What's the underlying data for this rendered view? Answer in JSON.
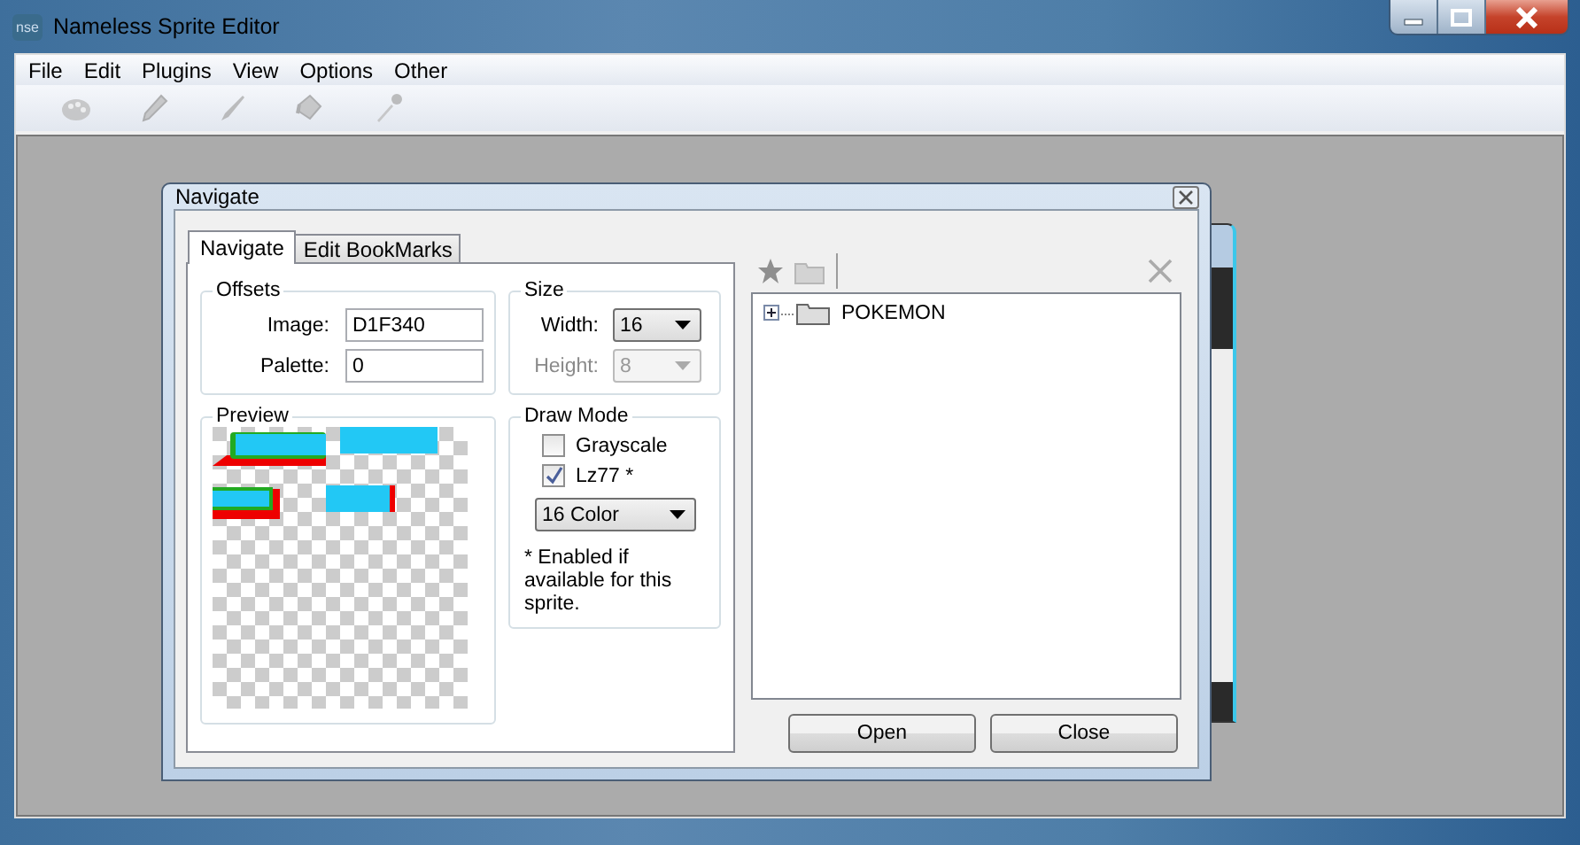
{
  "window": {
    "title": "Nameless Sprite Editor",
    "app_badge": "nse"
  },
  "menu": [
    "File",
    "Edit",
    "Plugins",
    "View",
    "Options",
    "Other"
  ],
  "toolbar": [
    {
      "kind": "palette",
      "disabled": true
    },
    {
      "kind": "pencil",
      "disabled": true
    },
    {
      "kind": "brush",
      "disabled": true
    },
    {
      "kind": "bucket",
      "disabled": true
    },
    {
      "kind": "dropper",
      "disabled": true
    }
  ],
  "dialog": {
    "title": "Navigate",
    "tabs": [
      {
        "label": "Navigate",
        "selected": true
      },
      {
        "label": "Edit BookMarks",
        "selected": false
      }
    ],
    "offsets": {
      "title": "Offsets",
      "fields": [
        {
          "label": "Image:",
          "value": "D1F340"
        },
        {
          "label": "Palette:",
          "value": "0"
        }
      ]
    },
    "size": {
      "title": "Size",
      "fields": [
        {
          "label": "Width:",
          "value": "16",
          "disabled": false
        },
        {
          "label": "Height:",
          "value": "8",
          "disabled": true
        }
      ]
    },
    "preview": {
      "title": "Preview"
    },
    "draw_mode": {
      "title": "Draw Mode",
      "options": [
        {
          "label": "Grayscale",
          "checked": false
        },
        {
          "label": "Lz77 *",
          "checked": true
        }
      ],
      "color_mode": "16 Color",
      "note": "* Enabled if available for this sprite."
    },
    "bookmark_tools": [
      {
        "kind": "star",
        "disabled": true
      },
      {
        "kind": "folder",
        "disabled": true
      },
      {
        "kind": "delete",
        "disabled": true
      }
    ],
    "tree": [
      {
        "label": "POKEMON",
        "expanded": false
      }
    ],
    "buttons": [
      "Open",
      "Close"
    ]
  }
}
